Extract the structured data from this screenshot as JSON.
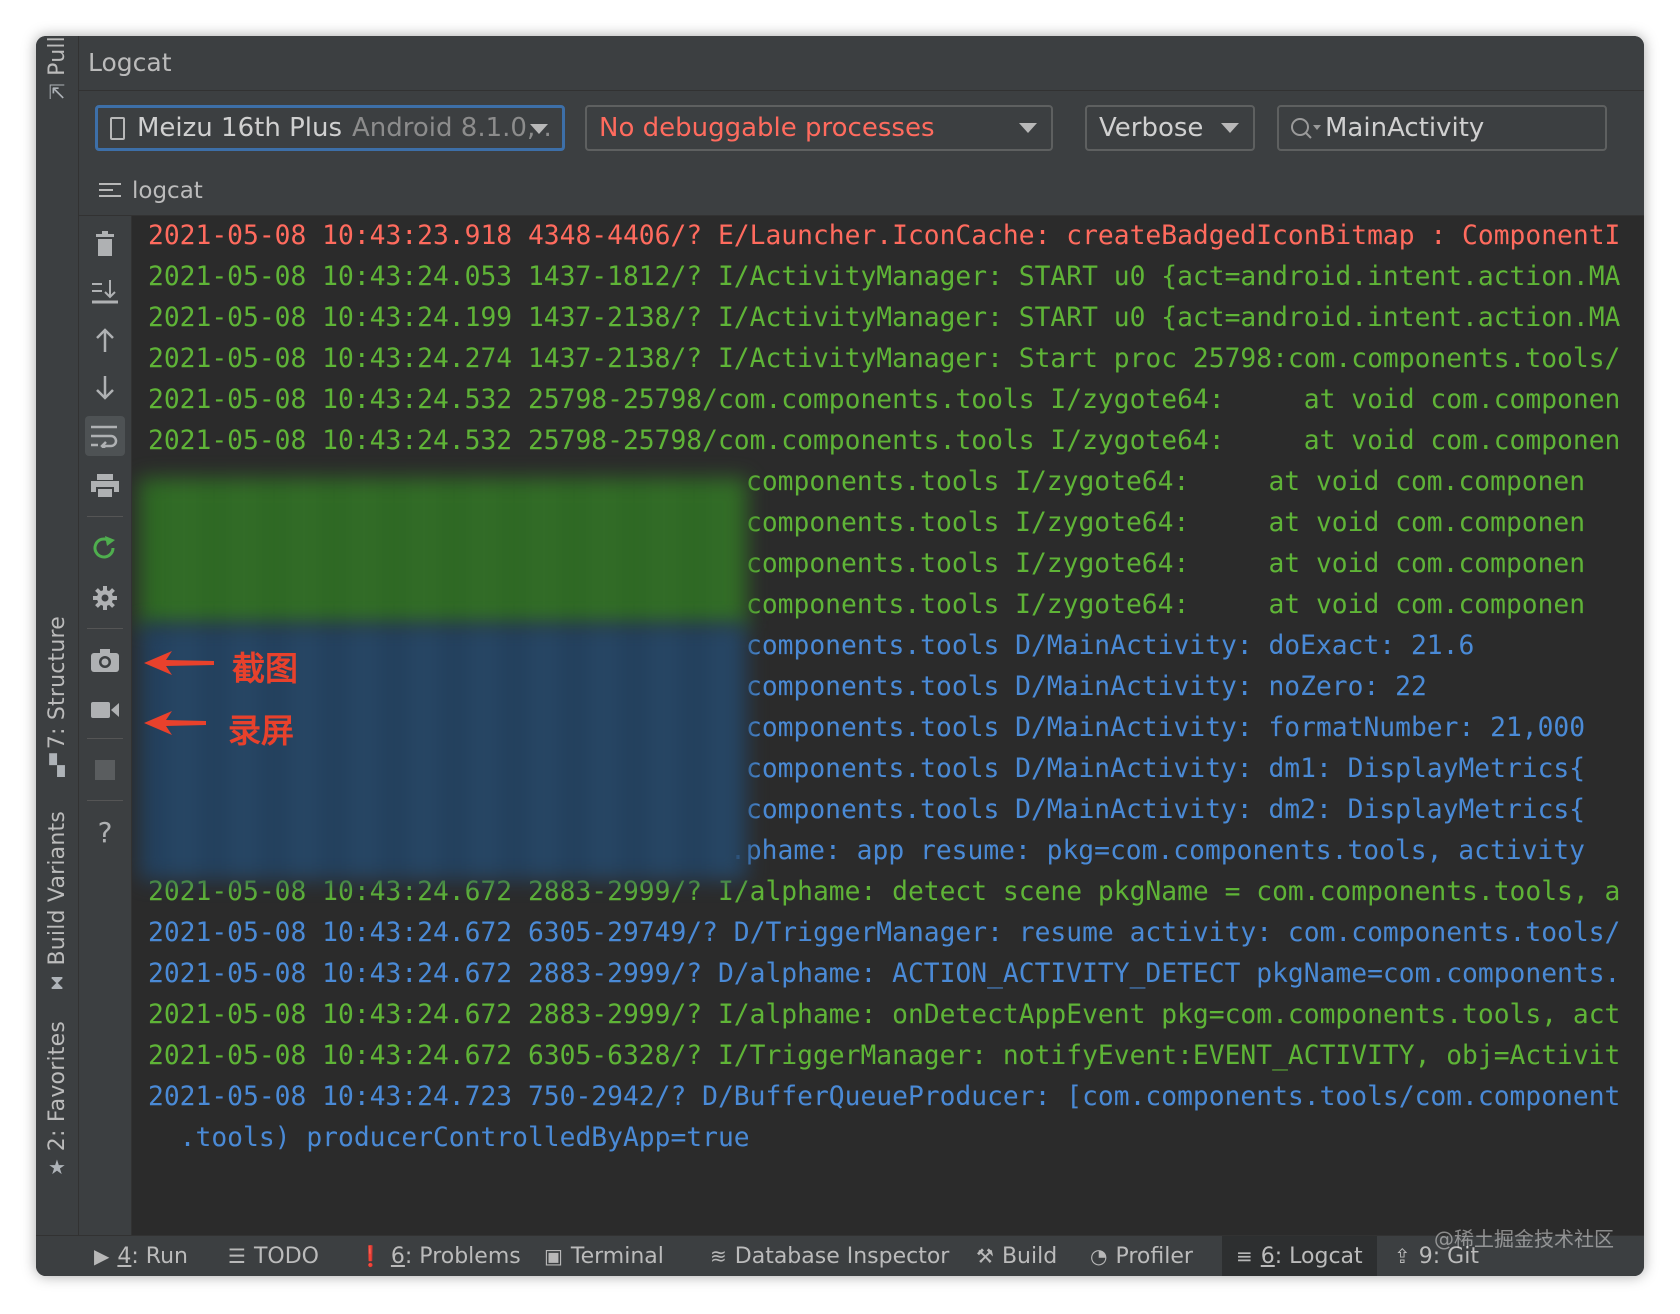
{
  "window": {
    "title": "Logcat"
  },
  "left_strip": {
    "pull": "Pull",
    "structure": "7: Structure",
    "build_variants": "Build Variants",
    "favorites": "2: Favorites"
  },
  "toolbar": {
    "device": "Meizu 16th Plus",
    "device_detail": "Android 8.1.0, .",
    "process": "No debuggable processes",
    "level": "Verbose",
    "filter_value": "MainActivity"
  },
  "subheader": {
    "label": "logcat"
  },
  "icons": {
    "clear": "trash-icon",
    "scroll_end": "scroll-to-end-icon",
    "up": "arrow-up-icon",
    "down": "arrow-down-icon",
    "wrap": "soft-wrap-icon",
    "print": "print-icon",
    "restart": "restart-icon",
    "settings": "gear-icon",
    "screenshot": "camera-icon",
    "record": "video-camera-icon",
    "stop": "stop-icon",
    "help": "help-icon"
  },
  "colors": {
    "error": "#ff6b5e",
    "info": "#5fb437",
    "debug": "#4a8ad6",
    "annotation": "#e8412c",
    "selected_border": "#3d6fa8"
  },
  "annotations": {
    "screenshot": "截图",
    "record": "录屏"
  },
  "log": [
    {
      "level": "E",
      "text": "2021-05-08 10:43:23.918 4348-4406/? E/Launcher.IconCache: createBadgedIconBitmap : ComponentI"
    },
    {
      "level": "I",
      "text": "2021-05-08 10:43:24.053 1437-1812/? I/ActivityManager: START u0 {act=android.intent.action.MA"
    },
    {
      "level": "I",
      "text": "2021-05-08 10:43:24.199 1437-2138/? I/ActivityManager: START u0 {act=android.intent.action.MA"
    },
    {
      "level": "I",
      "text": "2021-05-08 10:43:24.274 1437-2138/? I/ActivityManager: Start proc 25798:com.components.tools/"
    },
    {
      "level": "I",
      "text": "2021-05-08 10:43:24.532 25798-25798/com.components.tools I/zygote64:     at void com.componen"
    },
    {
      "level": "I",
      "text": "2021-05-08 10:43:24.532 25798-25798/com.components.tools I/zygote64:     at void com.componen"
    },
    {
      "level": "I",
      "text": "components.tools I/zygote64:     at void com.componen"
    },
    {
      "level": "I",
      "text": "components.tools I/zygote64:     at void com.componen"
    },
    {
      "level": "I",
      "text": "components.tools I/zygote64:     at void com.componen"
    },
    {
      "level": "I",
      "text": "components.tools I/zygote64:     at void com.componen"
    },
    {
      "level": "D",
      "text": "components.tools D/MainActivity: doExact: 21.6"
    },
    {
      "level": "D",
      "text": "components.tools D/MainActivity: noZero: 22"
    },
    {
      "level": "D",
      "text": "components.tools D/MainActivity: formatNumber: 21,000"
    },
    {
      "level": "D",
      "text": "components.tools D/MainActivity: dm1: DisplayMetrics{"
    },
    {
      "level": "D",
      "text": "components.tools D/MainActivity: dm2: DisplayMetrics{"
    },
    {
      "level": "D",
      "text": ".phame: app resume: pkg=com.components.tools, activity"
    },
    {
      "level": "I",
      "text": "2021-05-08 10:43:24.672 2883-2999/? I/alphame: detect scene pkgName = com.components.tools, a"
    },
    {
      "level": "D",
      "text": "2021-05-08 10:43:24.672 6305-29749/? D/TriggerManager: resume activity: com.components.tools/"
    },
    {
      "level": "D",
      "text": "2021-05-08 10:43:24.672 2883-2999/? D/alphame: ACTION_ACTIVITY_DETECT pkgName=com.components."
    },
    {
      "level": "I",
      "text": "2021-05-08 10:43:24.672 2883-2999/? I/alphame: onDetectAppEvent pkg=com.components.tools, act"
    },
    {
      "level": "I",
      "text": "2021-05-08 10:43:24.672 6305-6328/? I/TriggerManager: notifyEvent:EVENT_ACTIVITY, obj=Activit"
    },
    {
      "level": "D",
      "text": "2021-05-08 10:43:24.723 750-2942/? D/BufferQueueProducer: [com.components.tools/com.component"
    },
    {
      "level": "D",
      "text": "  .tools) producerControlledByApp=true"
    }
  ],
  "bottom_tabs": {
    "run_num": "4",
    "run": ": Run",
    "todo": "TODO",
    "problems_num": "6",
    "problems": ": Problems",
    "terminal": "Terminal",
    "database": "Database Inspector",
    "build": "Build",
    "profiler": "Profiler",
    "logcat_num": "6",
    "logcat": ": Logcat",
    "git": "9: Git"
  },
  "watermark": "@稀土掘金技术社区"
}
